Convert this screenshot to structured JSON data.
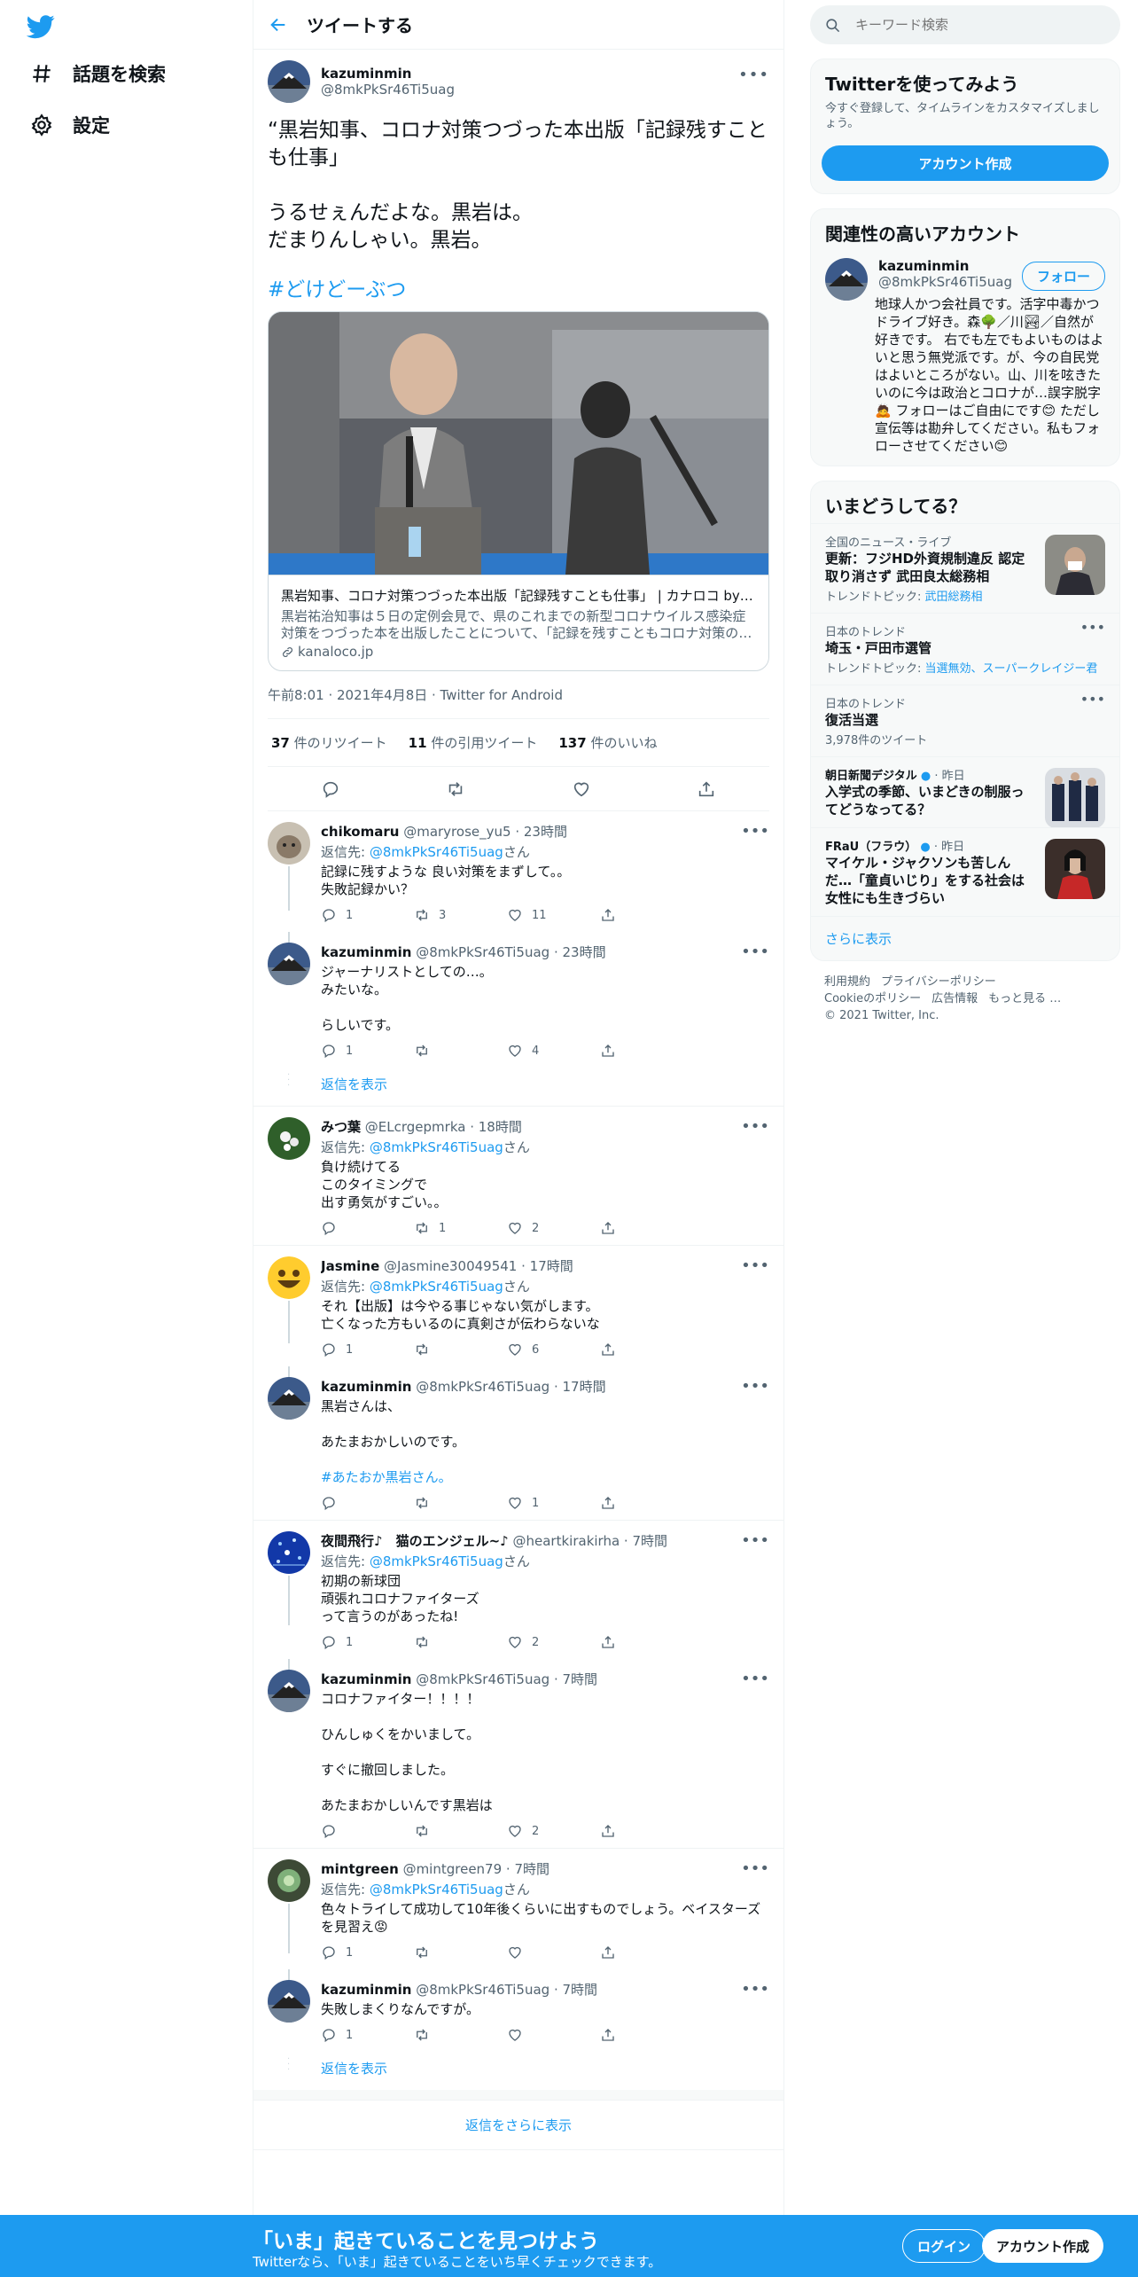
{
  "nav": {
    "explore": "話題を検索",
    "settings": "設定"
  },
  "header": {
    "title": "ツイートする"
  },
  "main_tweet": {
    "name": "kazuminmin",
    "handle": "@8mkPkSr46Ti5uag",
    "text": "“黒岩知事、コロナ対策つづった本出版「記録残すことも仕事」\n\nうるせぇんだよな。黒岩は。\nだまりんしゃい。黒岩。",
    "hashtag": "#どけどーぶつ",
    "card": {
      "title": "黒岩知事、コロナ対策つづった本出版「記録残すことも仕事」 | カナロコ by 神奈川新聞",
      "description": "黒岩祐治知事は５日の定例会見で、県のこれまでの新型コロナウイルス感染症対策をつづった本を出版したことについて、「記録を残すこともコロナ対策の一つ」と述べた。",
      "domain": "kanaloco.jp"
    },
    "meta": "午前8:01 · 2021年4月8日 · Twitter for Android",
    "retweets": "37",
    "retweets_label": "件のリツイート",
    "quotes": "11",
    "quotes_label": "件の引用ツイート",
    "likes": "137",
    "likes_label": "件のいいね"
  },
  "replies": [
    {
      "name": "chikomaru",
      "handle": "@maryrose_yu5",
      "time": "23時間",
      "replying": "@8mkPkSr46Ti5uag",
      "text": "記録に残すような 良い対策をまずして。。\n失敗記録かい？",
      "reply": "1",
      "rt": "3",
      "like": "11"
    },
    {
      "name": "kazuminmin",
      "handle": "@8mkPkSr46Ti5uag",
      "time": "23時間",
      "replying": "",
      "text": "ジャーナリストとしての…。\nみたいな。\n\nらしいです。",
      "reply": "1",
      "rt": "",
      "like": "4"
    },
    {
      "name": "みつ葉",
      "handle": "@ELcrgepmrka",
      "time": "18時間",
      "replying": "@8mkPkSr46Ti5uag",
      "text": "負け続けてる\nこのタイミングで\n出す勇気がすごい。。",
      "reply": "",
      "rt": "1",
      "like": "2"
    },
    {
      "name": "Jasmine",
      "handle": "@Jasmine30049541",
      "time": "17時間",
      "replying": "@8mkPkSr46Ti5uag",
      "text": "それ【出版】は今やる事じゃない気がします。\n亡くなった方もいるのに真剣さが伝わらないな",
      "reply": "1",
      "rt": "",
      "like": "6"
    },
    {
      "name": "kazuminmin",
      "handle": "@8mkPkSr46Ti5uag",
      "time": "17時間",
      "replying": "",
      "text": "黒岩さんは、\n\nあたまおかしいのです。",
      "hashtag": "#あたおか黒岩さん。",
      "reply": "",
      "rt": "",
      "like": "1"
    },
    {
      "name": "夜間飛行♪　猫のエンジェル~♪",
      "handle": "@heartkirakirha",
      "time": "7時間",
      "replying": "@8mkPkSr46Ti5uag",
      "text": "初期の新球団\n頑張れコロナファイターズ\nって言うのがあったね!",
      "reply": "1",
      "rt": "",
      "like": "2"
    },
    {
      "name": "kazuminmin",
      "handle": "@8mkPkSr46Ti5uag",
      "time": "7時間",
      "replying": "",
      "text": "コロナファイター！！！！\n\nひんしゅくをかいまして。\n\nすぐに撤回しました。\n\nあたまおかしいんです黒岩は",
      "reply": "",
      "rt": "",
      "like": "2"
    },
    {
      "name": "mintgreen",
      "handle": "@mintgreen79",
      "time": "7時間",
      "replying": "@8mkPkSr46Ti5uag",
      "text": "色々トライして成功して10年後くらいに出すものでしょう。ベイスターズを見習え😡",
      "reply": "1",
      "rt": "",
      "like": ""
    },
    {
      "name": "kazuminmin",
      "handle": "@8mkPkSr46Ti5uag",
      "time": "7時間",
      "replying": "",
      "text": "失敗しまくりなんですが。",
      "reply": "1",
      "rt": "",
      "like": ""
    }
  ],
  "replying_prefix": "返信先: ",
  "replying_suffix": "さん",
  "show_replies": "返信を表示",
  "show_more_replies": "返信をさらに表示",
  "search": {
    "placeholder": "キーワード検索"
  },
  "join": {
    "title": "Twitterを使ってみよう",
    "desc": "今すぐ登録して、タイムラインをカスタマイズしましょう。",
    "button": "アカウント作成"
  },
  "related": {
    "title": "関連性の高いアカウント",
    "name": "kazuminmin",
    "handle": "@8mkPkSr46Ti5uag",
    "follow": "フォロー",
    "bio": "地球人かつ会社員です。活字中毒かつドライブ好き。森🌳／川🏞／自然が好きです。 右でも左でもよいものはよいと思う無党派です。が、今の自民党はよいところがない。山、川を呟きたいのに今は政治とコロナが…誤字脱字🙇 フォローはご自由にです😊 ただし宣伝等は勘弁してください。私もフォローさせてください😊"
  },
  "trends": {
    "title": "いまどうしてる？",
    "items": [
      {
        "cat": "全国のニュース・ライブ",
        "title": "更新：フジHD外資規制違反 認定取り消さず 武田良太総務相",
        "sub_label": "トレンドトピック: ",
        "sub_links": "武田総務相"
      },
      {
        "cat": "日本のトレンド",
        "title": "埼玉・戸田市選管",
        "sub_label": "トレンドトピック: ",
        "sub_links": "当選無効、スーパークレイジー君"
      },
      {
        "cat": "日本のトレンド",
        "title": "復活当選",
        "sub_label": "3,978件のツイート",
        "sub_links": ""
      },
      {
        "cat": "朝日新聞デジタル",
        "time": "· 昨日",
        "title": "入学式の季節、いまどきの制服ってどうなってる？",
        "sub_label": "",
        "sub_links": ""
      },
      {
        "cat": "FRaU（フラウ）",
        "time": "· 昨日",
        "title": "マイケル・ジャクソンも苦しんだ…「童貞いじり」をする社会は女性にも生きづらい",
        "sub_label": "",
        "sub_links": ""
      }
    ],
    "more": "さらに表示"
  },
  "footer": {
    "terms": "利用規約",
    "privacy": "プライバシーポリシー",
    "cookie": "Cookieのポリシー",
    "ads": "広告情報",
    "more": "もっと見る …",
    "copyright": "© 2021 Twitter, Inc."
  },
  "banner": {
    "title": "「いま」起きていることを見つけよう",
    "subtitle": "Twitterなら、「いま」起きていることをいち早くチェックできます。",
    "login": "ログイン",
    "signup": "アカウント作成"
  },
  "colors": {
    "accent": "#1d9bf0",
    "text": "#0f1419",
    "muted": "#536471",
    "border": "#eff3f4"
  }
}
